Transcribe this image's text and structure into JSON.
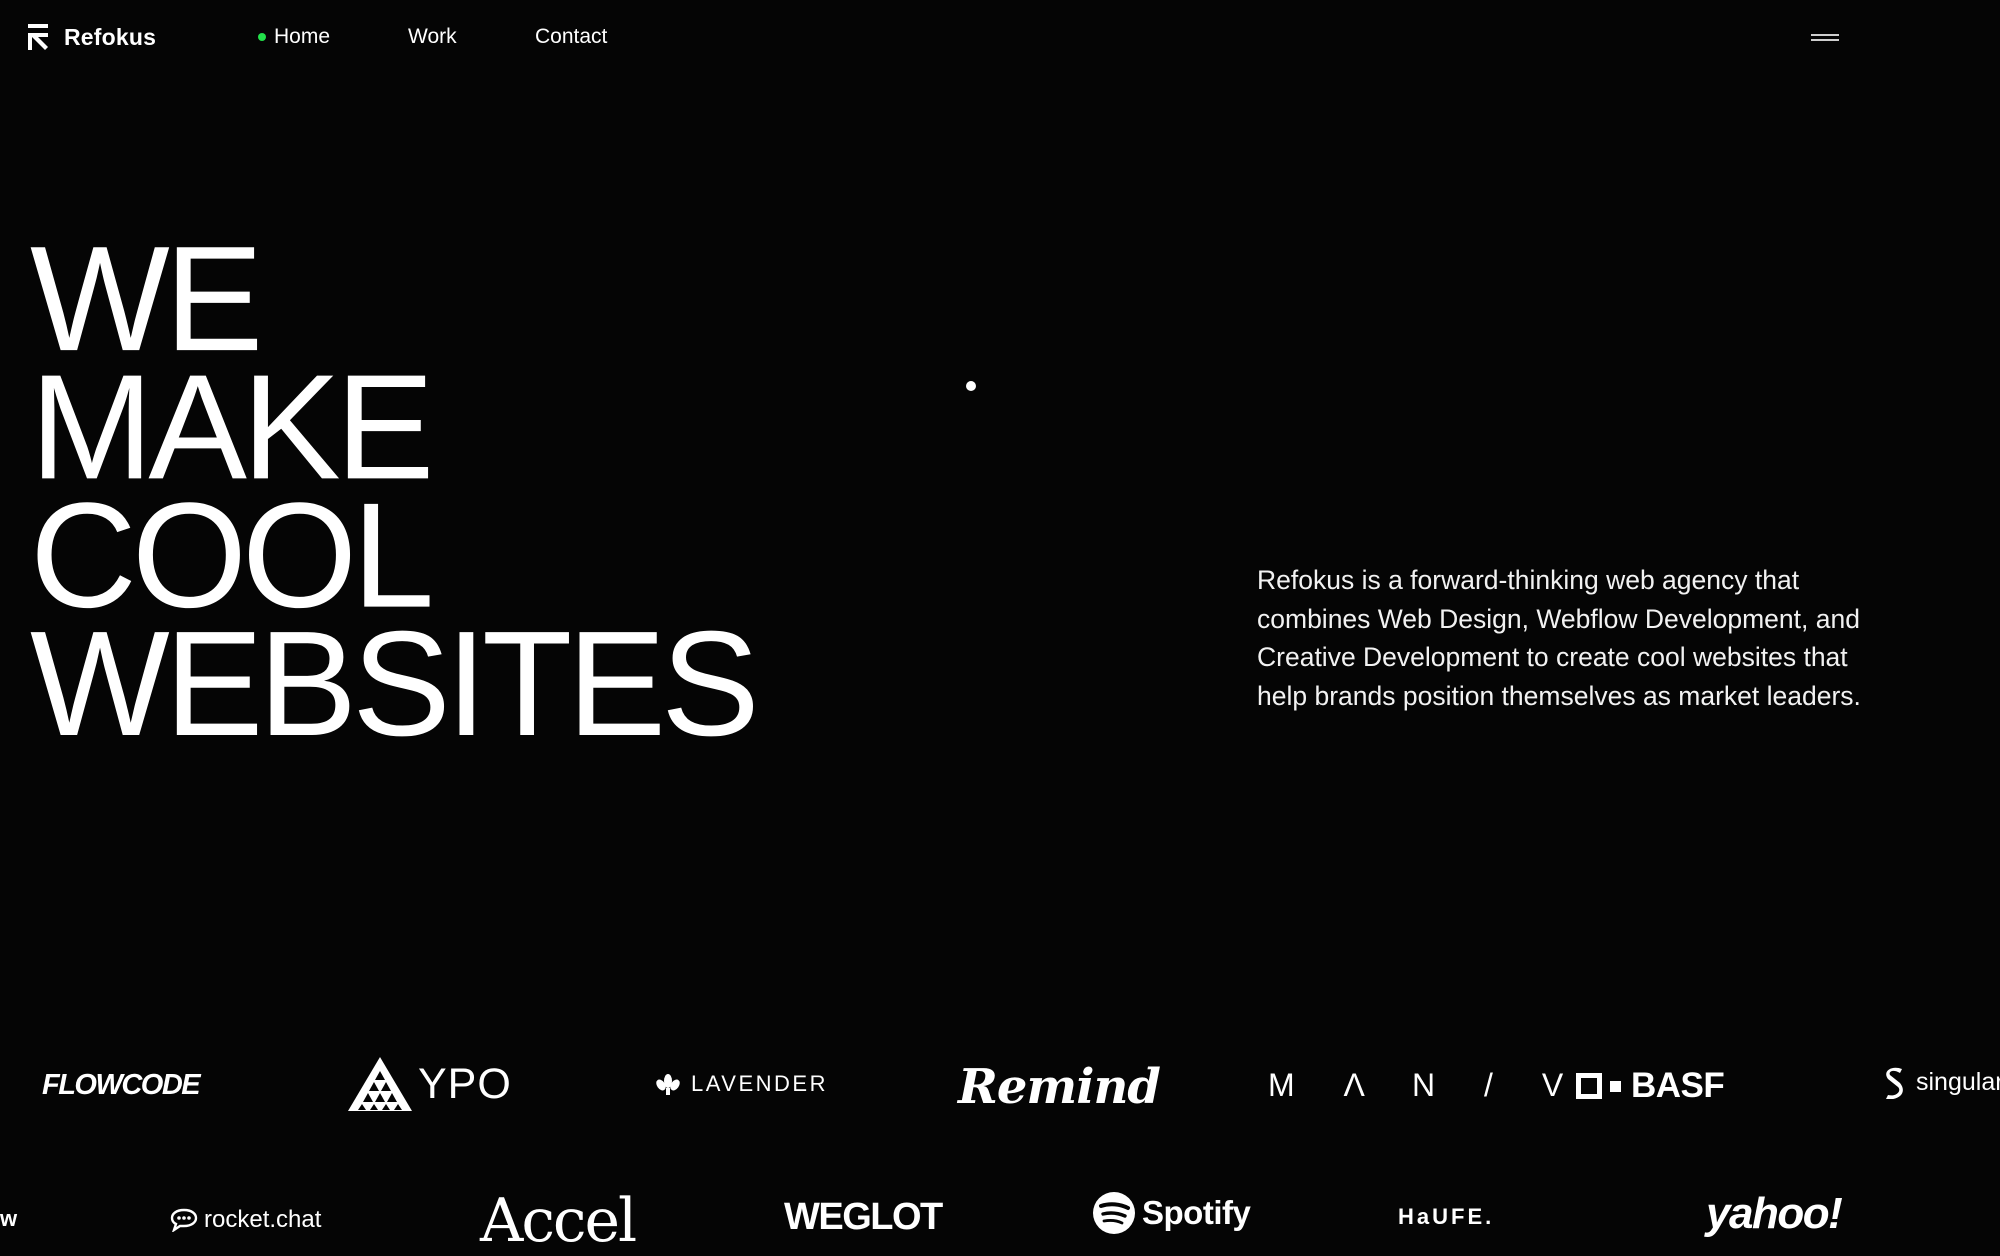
{
  "nav": {
    "brand": "Refokus",
    "links": [
      {
        "label": "Home"
      },
      {
        "label": "Work"
      },
      {
        "label": "Contact"
      }
    ],
    "active_indicator_color": "#22e04a"
  },
  "hero": {
    "title_lines": [
      "WE",
      "MAKE",
      "COOL",
      "WEBSITES"
    ],
    "intro": "Refokus is a forward-thinking web agency that combines Web Design, Webflow Development, and Creative Development to create cool websites that help brands position themselves as market leaders."
  },
  "clients": {
    "row1": [
      "FLOWCODE",
      "YPO",
      "LAVENDER",
      "Remind",
      "M Λ N / V",
      "BASF",
      "singular"
    ],
    "row2": [
      "w",
      "rocket.chat",
      "Accel",
      "WEGLOT",
      "Spotify",
      "HaUFE.",
      "yahoo!"
    ]
  },
  "theme": {
    "background": "#050505",
    "text": "#ffffff"
  }
}
